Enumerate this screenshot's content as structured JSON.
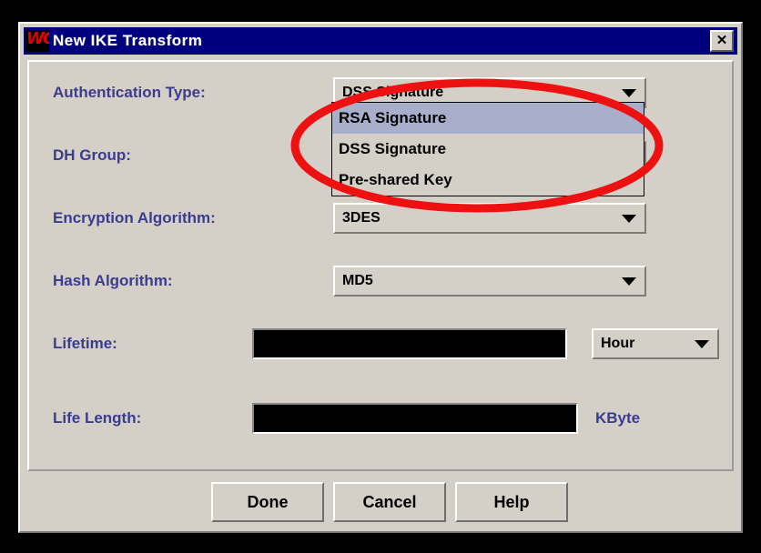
{
  "window": {
    "title": "New IKE Transform",
    "logo_icon": "watchguard-logo-icon",
    "logo_text": "WG",
    "close_label": "✕"
  },
  "form": {
    "rows": [
      {
        "label": "Authentication Type:",
        "control": "combo",
        "value": "DSS Signature"
      },
      {
        "label": "DH Group:",
        "control": "combo",
        "value": ""
      },
      {
        "label": "Encryption Algorithm:",
        "control": "combo",
        "value": "3DES"
      },
      {
        "label": "Hash Algorithm:",
        "control": "combo",
        "value": "MD5"
      },
      {
        "label": "Lifetime:",
        "control": "text+combo",
        "value": "",
        "unit": "Hour"
      },
      {
        "label": "Life Length:",
        "control": "text",
        "value": "",
        "unit": "KByte"
      }
    ]
  },
  "auth_dropdown": {
    "open": true,
    "options": [
      {
        "label": "RSA Signature",
        "selected": true
      },
      {
        "label": "DSS Signature",
        "selected": false
      },
      {
        "label": "Pre-shared Key",
        "selected": false
      }
    ]
  },
  "buttons": [
    {
      "label": "Done"
    },
    {
      "label": "Cancel"
    },
    {
      "label": "Help"
    }
  ],
  "annotation": {
    "shape": "ellipse",
    "color": "#ee1111",
    "stroke_width": 9,
    "target": "auth-dropdown-list"
  },
  "colors": {
    "titlebar": "#00007e",
    "face": "#d4d0c8",
    "label_text": "#3b3b8f",
    "highlight": "#a9aecb",
    "annotation_red": "#ee1111"
  }
}
